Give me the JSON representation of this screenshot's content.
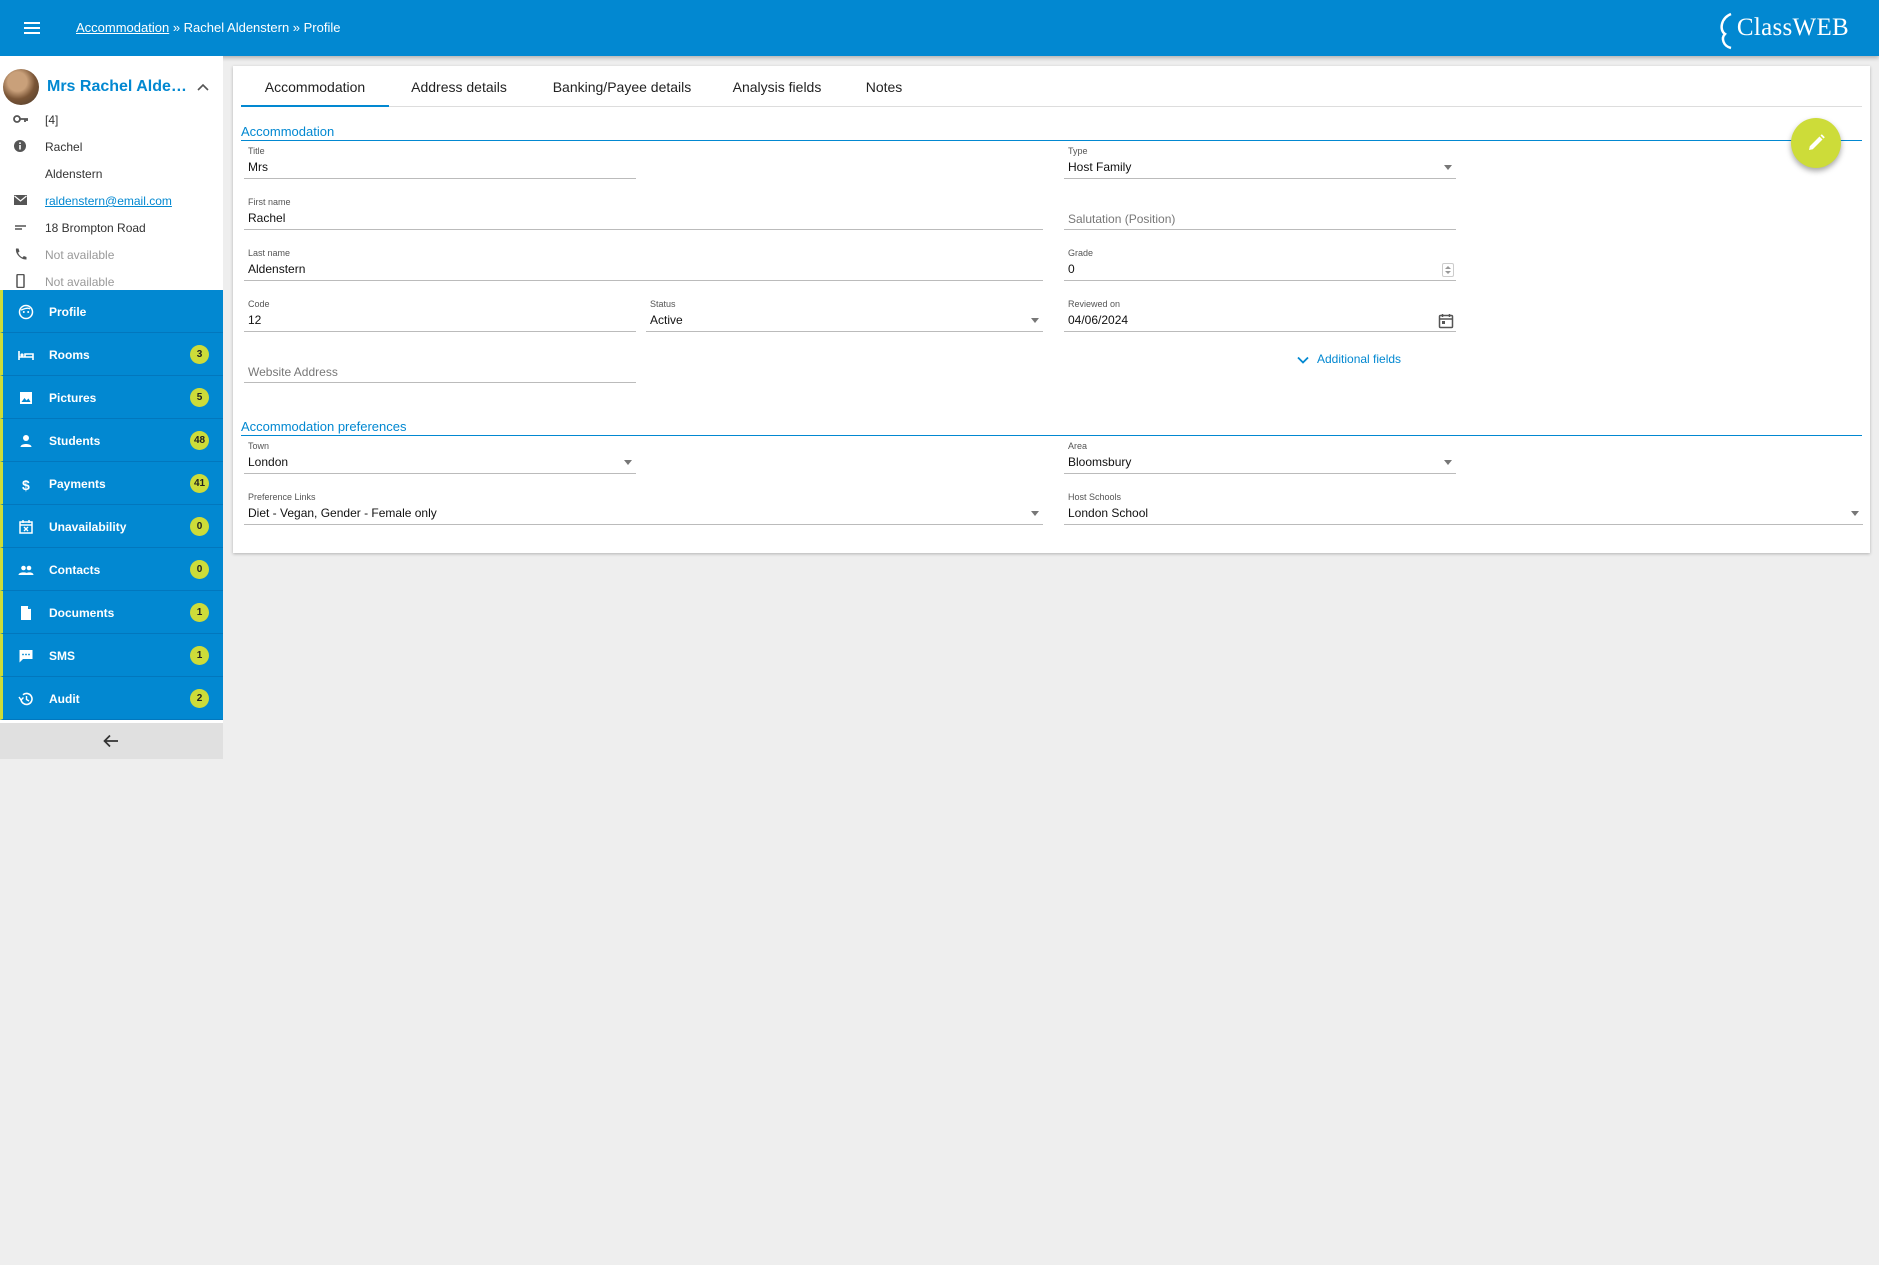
{
  "header": {
    "breadcrumb_link": "Accommodation",
    "breadcrumb_rest": " » Rachel Aldenstern » Profile",
    "logo_text": "ClassWEB"
  },
  "profile": {
    "name": "Mrs Rachel Alden...",
    "id": "[4]",
    "first_name": "Rachel",
    "last_name": "Aldenstern",
    "email": "raldenstern@email.com",
    "address": "18 Brompton Road",
    "phone": "Not available",
    "mobile": "Not available"
  },
  "nav": [
    {
      "label": "Profile",
      "badge": ""
    },
    {
      "label": "Rooms",
      "badge": "3"
    },
    {
      "label": "Pictures",
      "badge": "5"
    },
    {
      "label": "Students",
      "badge": "48"
    },
    {
      "label": "Payments",
      "badge": "41"
    },
    {
      "label": "Unavailability",
      "badge": "0"
    },
    {
      "label": "Contacts",
      "badge": "0"
    },
    {
      "label": "Documents",
      "badge": "1"
    },
    {
      "label": "SMS",
      "badge": "1"
    },
    {
      "label": "Audit",
      "badge": "2"
    }
  ],
  "tabs": [
    "Accommodation",
    "Address details",
    "Banking/Payee details",
    "Analysis fields",
    "Notes"
  ],
  "sections": {
    "accommodation": "Accommodation",
    "preferences": "Accommodation preferences"
  },
  "form": {
    "title": {
      "label": "Title",
      "value": "Mrs"
    },
    "type": {
      "label": "Type",
      "value": "Host Family"
    },
    "first_name": {
      "label": "First name",
      "value": "Rachel"
    },
    "salutation": {
      "placeholder": "Salutation (Position)"
    },
    "last_name": {
      "label": "Last name",
      "value": "Aldenstern"
    },
    "grade": {
      "label": "Grade",
      "value": "0"
    },
    "code": {
      "label": "Code",
      "value": "12"
    },
    "status": {
      "label": "Status",
      "value": "Active"
    },
    "reviewed_on": {
      "label": "Reviewed on",
      "value": "04/06/2024"
    },
    "website": {
      "placeholder": "Website Address"
    },
    "additional_fields": "Additional fields",
    "town": {
      "label": "Town",
      "value": "London"
    },
    "area": {
      "label": "Area",
      "value": "Bloomsbury"
    },
    "preference_links": {
      "label": "Preference Links",
      "value": "Diet - Vegan, Gender - Female only"
    },
    "host_schools": {
      "label": "Host Schools",
      "value": "London School"
    }
  },
  "icons": {
    "menu": "menu-icon",
    "edit": "pencil-icon",
    "back": "arrow-left-icon"
  },
  "colors": {
    "primary": "#0288d1",
    "accent": "#cddc39"
  }
}
